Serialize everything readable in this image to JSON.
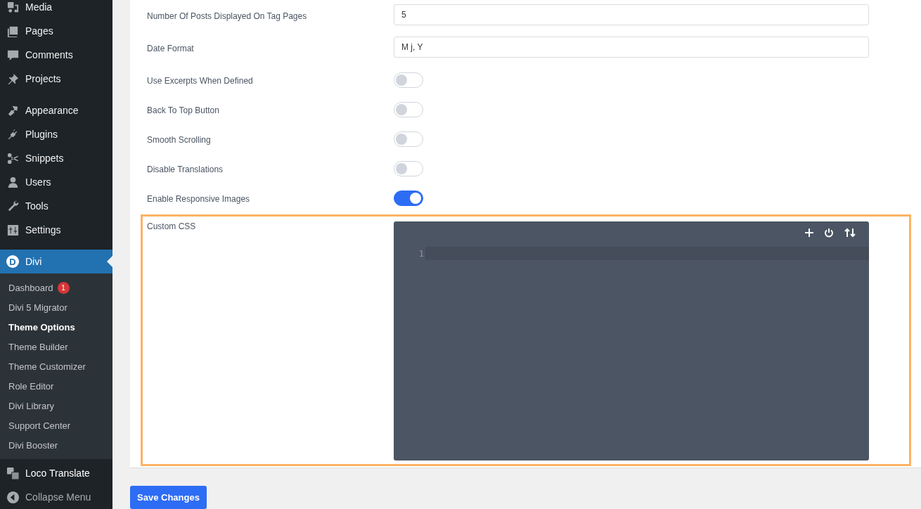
{
  "sidebar": {
    "groups": [
      {
        "items": [
          {
            "label": "Media"
          },
          {
            "label": "Pages"
          },
          {
            "label": "Comments"
          },
          {
            "label": "Projects"
          }
        ]
      },
      {
        "items": [
          {
            "label": "Appearance"
          },
          {
            "label": "Plugins"
          },
          {
            "label": "Snippets"
          },
          {
            "label": "Users"
          },
          {
            "label": "Tools"
          },
          {
            "label": "Settings"
          }
        ]
      }
    ],
    "current": {
      "label": "Divi",
      "logo": "D",
      "submenu": [
        {
          "label": "Dashboard",
          "badge": "1",
          "selected": false
        },
        {
          "label": "Divi 5 Migrator",
          "selected": false
        },
        {
          "label": "Theme Options",
          "selected": true
        },
        {
          "label": "Theme Builder",
          "selected": false
        },
        {
          "label": "Theme Customizer",
          "selected": false
        },
        {
          "label": "Role Editor",
          "selected": false
        },
        {
          "label": "Divi Library",
          "selected": false
        },
        {
          "label": "Support Center",
          "selected": false
        },
        {
          "label": "Divi Booster",
          "selected": false
        }
      ]
    },
    "after": [
      {
        "label": "Loco Translate"
      }
    ],
    "collapse": "Collapse Menu"
  },
  "settings": [
    {
      "kind": "input",
      "label": "Number Of Posts Displayed On Tag Pages",
      "value": "5"
    },
    {
      "kind": "input",
      "label": "Date Format",
      "value": "M j, Y"
    },
    {
      "kind": "toggle",
      "label": "Use Excerpts When Defined",
      "on": false
    },
    {
      "kind": "toggle",
      "label": "Back To Top Button",
      "on": false
    },
    {
      "kind": "toggle",
      "label": "Smooth Scrolling",
      "on": false
    },
    {
      "kind": "toggle",
      "label": "Disable Translations",
      "on": false
    },
    {
      "kind": "toggle",
      "label": "Enable Responsive Images",
      "on": true
    },
    {
      "kind": "code",
      "label": "Custom CSS",
      "highlighted": true,
      "line_numbers": [
        "1"
      ]
    }
  ],
  "save_button": "Save Changes"
}
